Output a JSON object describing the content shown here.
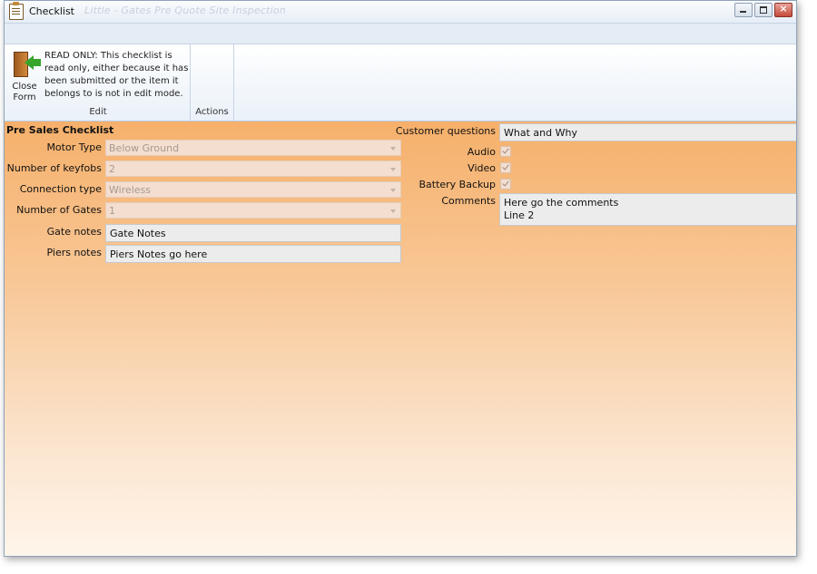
{
  "window": {
    "title": "Checklist",
    "background_title": "Little - Gates Pre Quote Site Inspection"
  },
  "ribbon": {
    "close_button_label": "Close Form",
    "readonly_message": "READ ONLY: This checklist is read only, either because it has been submitted or the item it belongs to is not in edit mode.",
    "groups": [
      "Edit",
      "Actions"
    ]
  },
  "form": {
    "section_title": "Pre Sales Checklist",
    "left_fields": [
      {
        "label": "Motor Type",
        "value": "Below Ground",
        "type": "combo"
      },
      {
        "label": "Number of keyfobs",
        "value": "2",
        "type": "combo"
      },
      {
        "label": "Connection type",
        "value": "Wireless",
        "type": "combo"
      },
      {
        "label": "Number of Gates",
        "value": "1",
        "type": "combo"
      },
      {
        "label": "Gate notes",
        "value": "Gate Notes",
        "type": "text"
      },
      {
        "label": "Piers notes",
        "value": "Piers Notes go here",
        "type": "text"
      }
    ],
    "right_fields": {
      "customer_questions": {
        "label": "Customer questions",
        "value": "What and Why"
      },
      "audio": {
        "label": "Audio",
        "checked": true
      },
      "video": {
        "label": "Video",
        "checked": true
      },
      "battery_backup": {
        "label": "Battery Backup",
        "checked": true
      },
      "comments": {
        "label": "Comments",
        "lines": [
          "Here go the comments",
          "Line 2"
        ]
      }
    }
  },
  "colors": {
    "content_top": "#f6b06b",
    "content_bottom": "#fff5ea",
    "ribbon": "#eaf1f9"
  }
}
